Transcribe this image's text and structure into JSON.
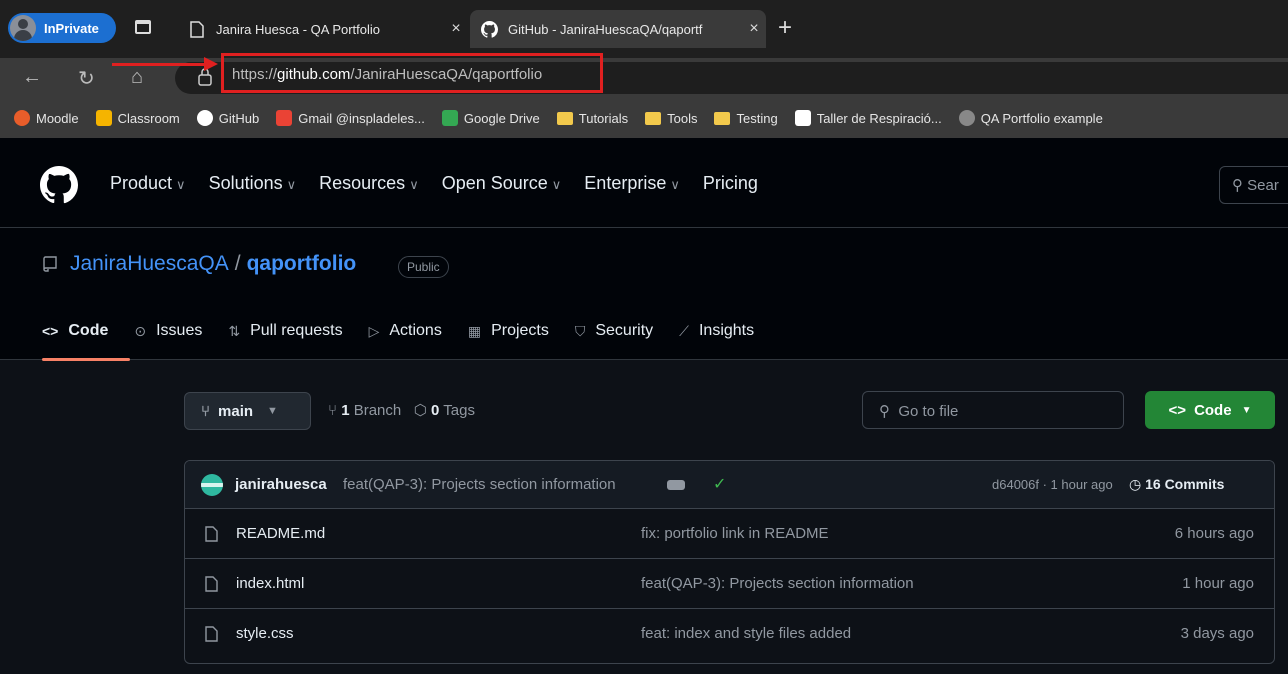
{
  "browser": {
    "inprivate_label": "InPrivate",
    "tabs": [
      {
        "title": "Janira Huesca - QA Portfolio",
        "close": "×"
      },
      {
        "title": "GitHub - JaniraHuescaQA/qaportf",
        "close": "×"
      }
    ],
    "new_tab": "+",
    "url_prefix": "https://",
    "url_domain": "github.com",
    "url_path": "/JaniraHuescaQA/qaportfolio",
    "nav": {
      "back": "←",
      "reload": "↻",
      "home": "⌂"
    },
    "bookmarks": [
      {
        "label": "Moodle",
        "icon": "moodle-icon",
        "color": "#e85d2a"
      },
      {
        "label": "Classroom",
        "icon": "classroom-icon",
        "color": "#f5b400"
      },
      {
        "label": "GitHub",
        "icon": "github-icon",
        "color": "#ffffff"
      },
      {
        "label": "Gmail @inspladeles...",
        "icon": "gmail-icon",
        "color": "#ea4335"
      },
      {
        "label": "Google Drive",
        "icon": "drive-icon",
        "color": "#34a853"
      },
      {
        "label": "Tutorials",
        "icon": "folder-icon",
        "color": "#f2c94c"
      },
      {
        "label": "Tools",
        "icon": "folder-icon",
        "color": "#f2c94c"
      },
      {
        "label": "Testing",
        "icon": "folder-icon",
        "color": "#f2c94c"
      },
      {
        "label": "Taller de Respiració...",
        "icon": "notion-icon",
        "color": "#ffffff"
      },
      {
        "label": "QA Portfolio example",
        "icon": "github-icon",
        "color": "#888888"
      }
    ]
  },
  "github": {
    "nav": [
      "Product",
      "Solutions",
      "Resources",
      "Open Source",
      "Enterprise",
      "Pricing"
    ],
    "search_placeholder": "Sear",
    "repo_owner": "JaniraHuescaQA",
    "repo_separator": "/",
    "repo_name": "qaportfolio",
    "visibility": "Public",
    "tabs": [
      {
        "label": "Code",
        "icon": "code-icon",
        "glyph": "<>"
      },
      {
        "label": "Issues",
        "icon": "issue-icon",
        "glyph": "⊙"
      },
      {
        "label": "Pull requests",
        "icon": "pull-request-icon",
        "glyph": "⇅"
      },
      {
        "label": "Actions",
        "icon": "play-icon",
        "glyph": "▷"
      },
      {
        "label": "Projects",
        "icon": "table-icon",
        "glyph": "▦"
      },
      {
        "label": "Security",
        "icon": "shield-icon",
        "glyph": "⛉"
      },
      {
        "label": "Insights",
        "icon": "graph-icon",
        "glyph": "⟋"
      }
    ],
    "branch": "main",
    "branch_count": "1",
    "branch_label": "Branch",
    "tag_count": "0",
    "tag_label": "Tags",
    "goto_file": "Go to file",
    "code_button": "Code",
    "latest_commit": {
      "user": "janirahuesca",
      "message": "feat(QAP-3): Projects section information",
      "hash_time": "d64006f · 1 hour ago",
      "commits": "16 Commits"
    },
    "files": [
      {
        "name": "README.md",
        "message": "fix: portfolio link in README",
        "date": "6 hours ago"
      },
      {
        "name": "index.html",
        "message": "feat(QAP-3): Projects section information",
        "date": "1 hour ago"
      },
      {
        "name": "style.css",
        "message": "feat: index and style files added",
        "date": "3 days ago"
      }
    ]
  }
}
